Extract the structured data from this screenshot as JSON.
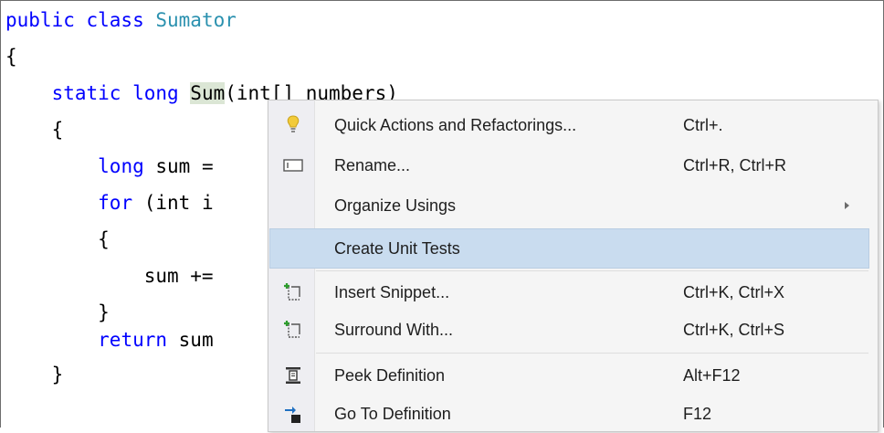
{
  "code": {
    "line1": {
      "kw": "public class ",
      "type": "Sumator"
    },
    "line2": "{",
    "line3": {
      "indent": "    ",
      "kw": "static long ",
      "name": "Sum",
      "rest": "(int[] numbers)"
    },
    "line4": "    {",
    "line5": {
      "indent": "        ",
      "kw": "long",
      "rest": " sum = "
    },
    "line6": {
      "indent": "        ",
      "kw": "for",
      "rest": " (int i"
    },
    "line7": "        {",
    "line8": "            sum +=",
    "line9": "        }",
    "line10": {
      "indent": "        ",
      "kw": "return",
      "rest": " sum"
    },
    "line11": "    }"
  },
  "context_menu": {
    "items": [
      {
        "label": "Quick Actions and Refactorings...",
        "shortcut": "Ctrl+.",
        "icon": "lightbulb-icon"
      },
      {
        "label": "Rename...",
        "shortcut": "Ctrl+R, Ctrl+R",
        "icon": "rename-icon"
      },
      {
        "label": "Organize Usings",
        "shortcut": "",
        "icon": ""
      },
      {
        "label": "Create Unit Tests",
        "shortcut": "",
        "icon": "",
        "highlighted": true
      },
      {
        "label": "Insert Snippet...",
        "shortcut": "Ctrl+K, Ctrl+X",
        "icon": "insert-snippet-icon"
      },
      {
        "label": "Surround With...",
        "shortcut": "Ctrl+K, Ctrl+S",
        "icon": "surround-with-icon"
      },
      {
        "label": "Peek Definition",
        "shortcut": "Alt+F12",
        "icon": "peek-definition-icon"
      },
      {
        "label": "Go To Definition",
        "shortcut": "F12",
        "icon": "go-to-definition-icon"
      }
    ],
    "colors": {
      "highlight": "#c9dcef",
      "keyword": "#0000ff",
      "type": "#2b91af"
    }
  }
}
